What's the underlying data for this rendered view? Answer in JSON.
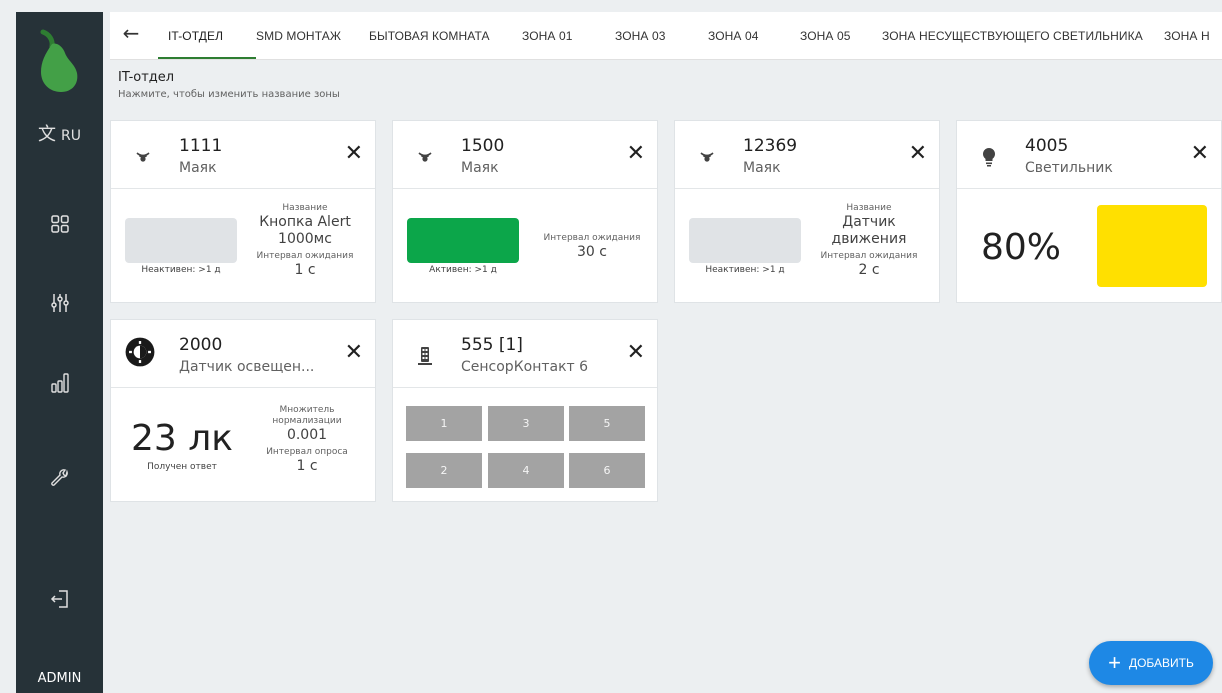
{
  "sidebar": {
    "lang": "RU",
    "lang_icon": "translate-icon",
    "nav": [
      "dashboard-grid-icon",
      "sliders-icon",
      "bar-chart-icon",
      "wrench-icon",
      "logout-icon"
    ],
    "user": "ADMIN"
  },
  "tabs": [
    "IT-ОТДЕЛ",
    "SMD МОНТАЖ",
    "БЫТОВАЯ КОМНАТА",
    "ЗОНА 01",
    "ЗОНА 03",
    "ЗОНА 04",
    "ЗОНА 05",
    "ЗОНА НЕСУЩЕСТВУЮЩЕГО СВЕТИЛЬНИКА",
    "ЗОНА Н"
  ],
  "zone": {
    "name": "IT-отдел",
    "hint": "Нажмите, чтобы изменить название зоны"
  },
  "cards": {
    "c1": {
      "num": "1111",
      "type": "Маяк",
      "status": "Неактивен: >1 д",
      "status_color": "#e0e3e6",
      "name_label": "Название",
      "name_line1": "Кнопка Alert",
      "name_line2": "1000мс",
      "interval_label": "Интервал ожидания",
      "interval": "1 с"
    },
    "c2": {
      "num": "1500",
      "type": "Маяк",
      "status": "Активен: >1 д",
      "status_color": "#0ca64a",
      "interval_label": "Интервал ожидания",
      "interval": "30 с"
    },
    "c3": {
      "num": "12369",
      "type": "Маяк",
      "status": "Неактивен: >1 д",
      "status_color": "#e0e3e6",
      "name_label": "Название",
      "name_line1": "Датчик",
      "name_line2": "движения",
      "interval_label": "Интервал ожидания",
      "interval": "2 с"
    },
    "c4": {
      "num": "4005",
      "type": "Светильник",
      "level": "80%",
      "color": "#ffe000"
    },
    "c5": {
      "num": "2000",
      "type": "Датчик освещен...",
      "lux": "23 лк",
      "reply": "Получен ответ",
      "mult_label1": "Множитель",
      "mult_label2": "нормализации",
      "mult": "0.001",
      "poll_label": "Интервал опроса",
      "poll": "1 с"
    },
    "c6": {
      "num": "555 [1]",
      "type": "СенсорКонтакт 6",
      "buttons": [
        "1",
        "3",
        "5",
        "2",
        "4",
        "6"
      ]
    }
  },
  "add_button": "ДОБАВИТЬ"
}
